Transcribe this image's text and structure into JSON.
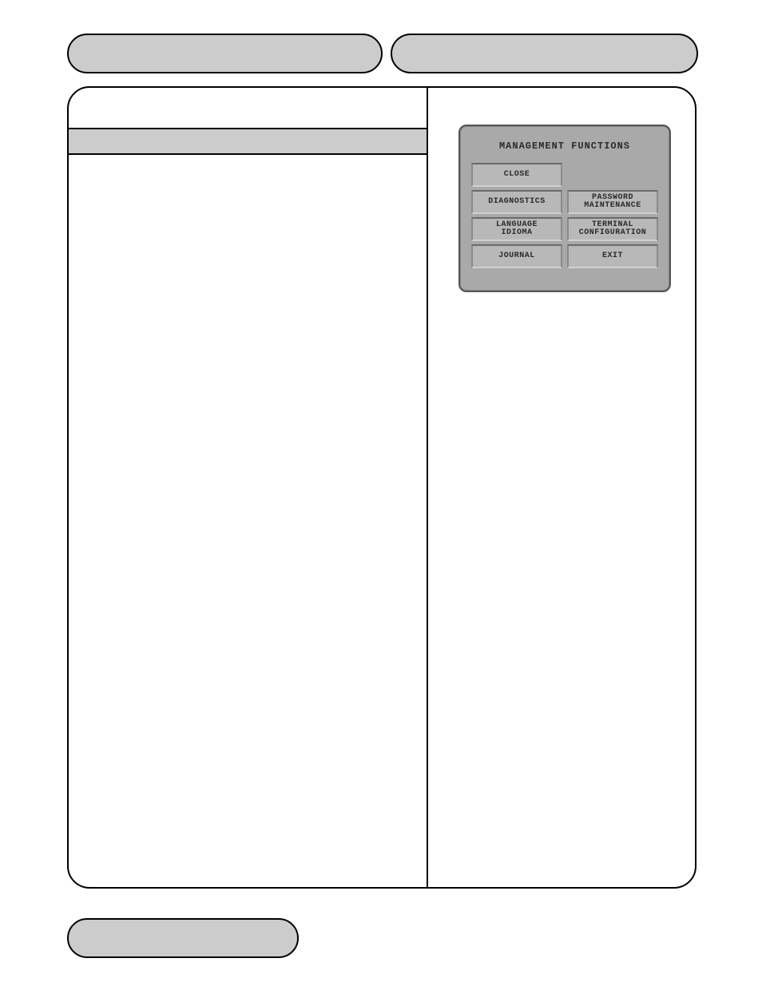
{
  "terminal": {
    "title": "MANAGEMENT FUNCTIONS",
    "buttons": {
      "close": "CLOSE",
      "diagnostics": "DIAGNOSTICS",
      "password_maintenance": "PASSWORD\nMAINTENANCE",
      "language_idioma": "LANGUAGE\nIDIOMA",
      "terminal_configuration": "TERMINAL\nCONFIGURATION",
      "journal": "JOURNAL",
      "exit": "EXIT"
    }
  }
}
